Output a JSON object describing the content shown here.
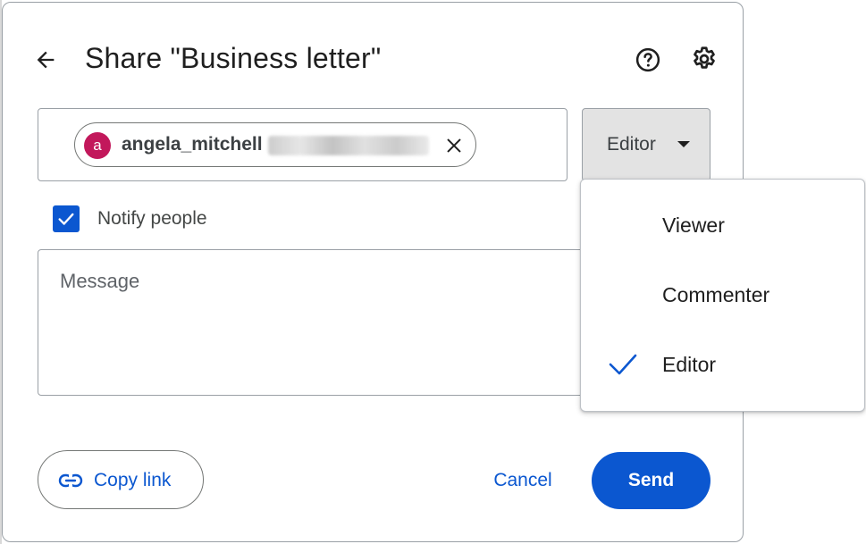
{
  "dialog": {
    "title": "Share \"Business letter\"",
    "icons": {
      "back": "arrow-left-icon",
      "help": "help-circle-icon",
      "settings": "gear-icon"
    }
  },
  "recipients": {
    "chips": [
      {
        "avatar_letter": "a",
        "avatar_color": "#c2185b",
        "name": "angela_mitchell",
        "email_domain_redacted": true
      }
    ]
  },
  "role_select": {
    "selected": "Editor",
    "options": [
      "Viewer",
      "Commenter",
      "Editor"
    ]
  },
  "notify": {
    "label": "Notify people",
    "checked": true
  },
  "message": {
    "placeholder": "Message"
  },
  "actions": {
    "copy_link_label": "Copy link",
    "cancel_label": "Cancel",
    "send_label": "Send"
  },
  "colors": {
    "accent": "#0b57d0",
    "avatar": "#c2185b"
  }
}
